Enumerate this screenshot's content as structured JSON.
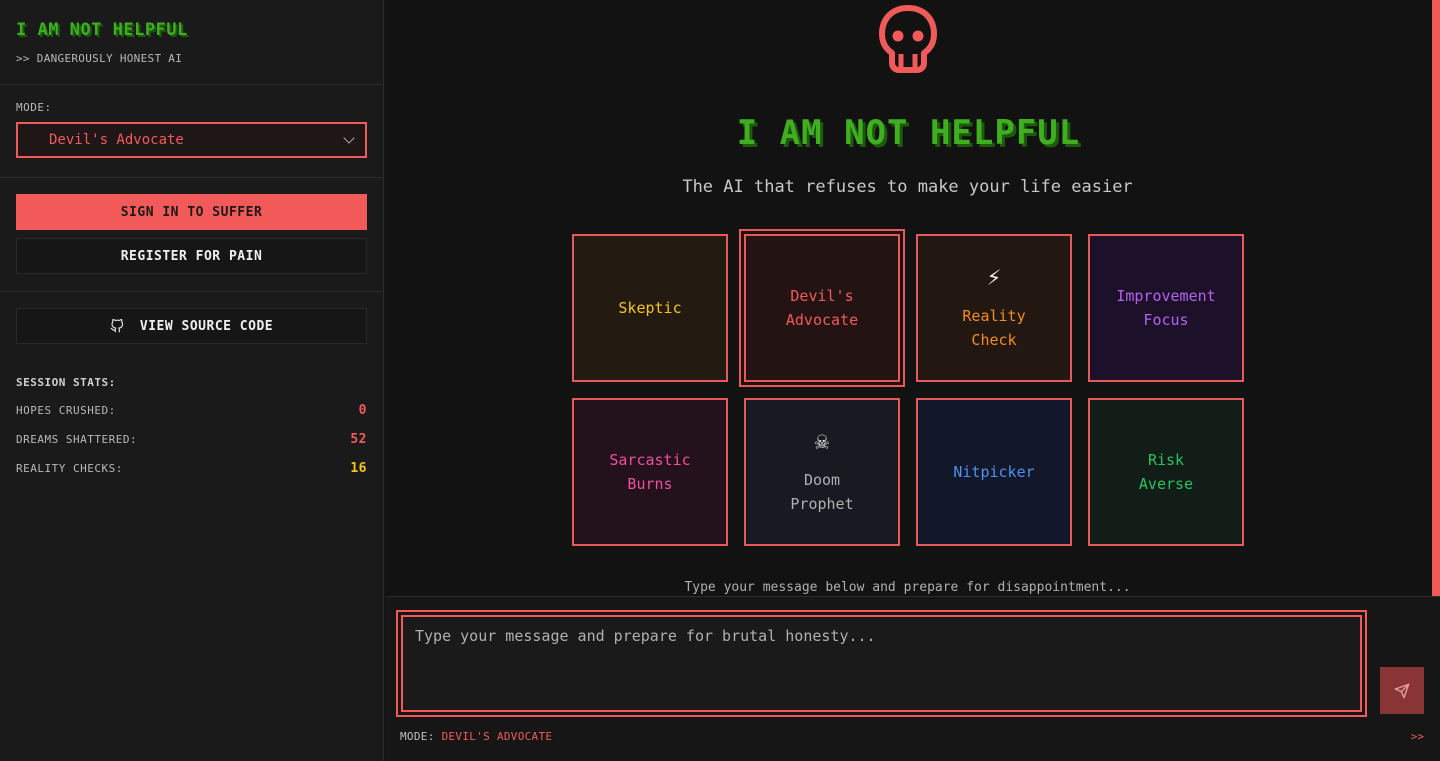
{
  "brand": {
    "title": "I AM NOT HELPFUL",
    "subtitle": ">> DANGEROUSLY HONEST AI"
  },
  "mode": {
    "label": "MODE:",
    "selected": "Devil's Advocate"
  },
  "auth": {
    "sign_in": "SIGN IN TO SUFFER",
    "register": "REGISTER FOR PAIN"
  },
  "source": {
    "label": "VIEW SOURCE CODE",
    "icon": "github-icon"
  },
  "stats": {
    "title": "SESSION STATS:",
    "rows": [
      {
        "label": "HOPES CRUSHED:",
        "value": "0",
        "color": "#f25a5a"
      },
      {
        "label": "DREAMS SHATTERED:",
        "value": "52",
        "color": "#f25a5a"
      },
      {
        "label": "REALITY CHECKS:",
        "value": "16",
        "color": "#f5c518"
      }
    ]
  },
  "hero": {
    "icon": "skull-icon",
    "title": "I AM NOT HELPFUL",
    "subtitle": "The AI that refuses to make your life easier"
  },
  "modes": [
    {
      "label": "Skeptic",
      "icon": "",
      "color": "#f5c518",
      "bg": "#231a11",
      "selected": false
    },
    {
      "label": "Devil's\nAdvocate",
      "icon": "",
      "color": "#f25a5a",
      "bg": "#231313",
      "selected": true
    },
    {
      "label": "Reality\nCheck",
      "icon": "⚡",
      "color": "#f58a1f",
      "bg": "#231811",
      "selected": false
    },
    {
      "label": "Improvement\nFocus",
      "icon": "",
      "color": "#b461f0",
      "bg": "#1c1128",
      "selected": false
    },
    {
      "label": "Sarcastic\nBurns",
      "icon": "",
      "color": "#ee4fa0",
      "bg": "#23111b",
      "selected": false
    },
    {
      "label": "Doom\nProphet",
      "icon": "☠",
      "color": "#b0b0b0",
      "bg": "#171a20",
      "selected": false
    },
    {
      "label": "Nitpicker",
      "icon": "",
      "color": "#4f8ff0",
      "bg": "#12182a",
      "selected": false
    },
    {
      "label": "Risk\nAverse",
      "icon": "",
      "color": "#28c35f",
      "bg": "#111d16",
      "selected": false
    }
  ],
  "hint": "Type your message below and prepare for disappointment...",
  "composer": {
    "placeholder": "Type your message and prepare for brutal honesty...",
    "mode_label": "MODE:",
    "mode_value": "DEVIL'S ADVOCATE",
    "arrows": ">>",
    "send_icon": "send-icon"
  }
}
